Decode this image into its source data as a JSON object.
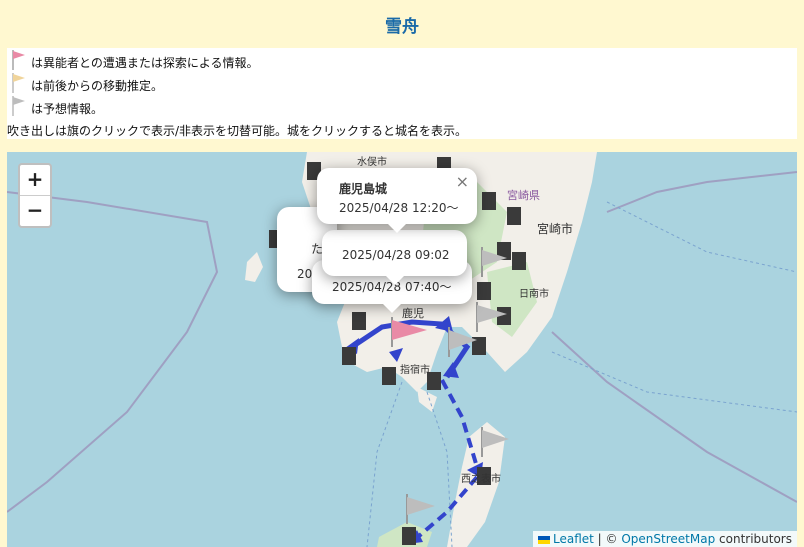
{
  "header": {
    "title": "雪舟"
  },
  "legend": {
    "items": [
      {
        "text": "は異能者との遭遇または探索による情報。",
        "flag_color": "#e98aa6"
      },
      {
        "text": "は前後からの移動推定。",
        "flag_color": "#f0d49b"
      },
      {
        "text": "は予想情報。",
        "flag_color": "#bdbdbd"
      }
    ],
    "note": "吹き出しは旗のクリックで表示/非表示を切替可能。城をクリックすると城名を表示。"
  },
  "map": {
    "zoom_in": "+",
    "zoom_out": "−",
    "place_labels": {
      "minamata": "水俣市",
      "miyazaki_pref": "宮崎県",
      "miyazaki_city": "宮崎市",
      "nichinan": "日南市",
      "ibusuki": "指宿市",
      "nishinoomote": "西之表市",
      "kagoshima_partial": "鹿児"
    },
    "popups": {
      "main": {
        "name": "鹿児島城",
        "time": "2025/04/28 12:20〜",
        "close": "×"
      },
      "second": {
        "time": "2025/04/28 09:02"
      },
      "third": {
        "time": "2025/04/28 07:40〜"
      },
      "left_fragment": {
        "text": "20"
      },
      "left_fragment2": {
        "text": "た"
      }
    },
    "attribution": {
      "leaflet": "Leaflet",
      "separator": " | © ",
      "osm": "OpenStreetMap",
      "suffix": " contributors"
    },
    "colors": {
      "sea": "#aad3df",
      "land": "#f2efe9",
      "forest": "#cfe6c4",
      "route": "#3344cc",
      "flag_pink": "#e98aa6",
      "flag_gray": "#bdbdbd"
    }
  }
}
